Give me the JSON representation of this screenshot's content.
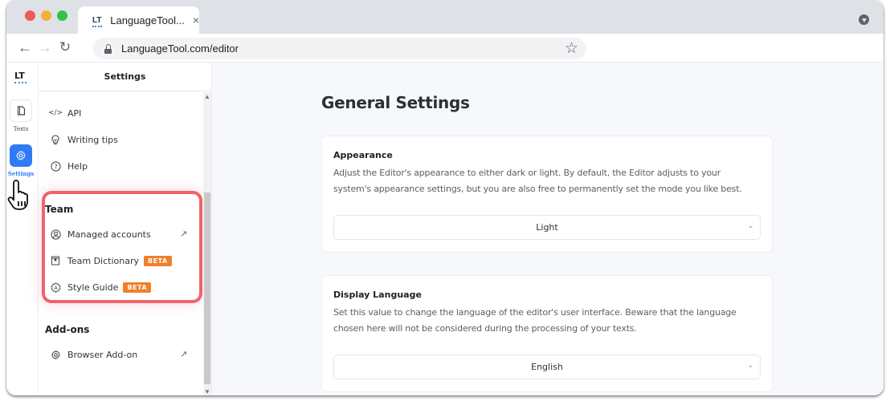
{
  "browser": {
    "tab_title": "LanguageTool...",
    "tab_favicon": "LT",
    "tab_close": "×",
    "url": "LanguageTool.com/editor",
    "nav": {
      "back": "←",
      "forward": "→",
      "reload": "↻"
    },
    "bookmark_icon": "☆"
  },
  "rail": {
    "logo": "LT",
    "items": [
      {
        "label": "Texts",
        "icon": "document-icon",
        "active": false
      },
      {
        "label": "Settings",
        "icon": "gear-icon",
        "active": true
      }
    ]
  },
  "settings_panel": {
    "title": "Settings",
    "items": [
      {
        "label": "API",
        "icon": "code-icon",
        "glyph": "</>"
      },
      {
        "label": "Writing tips",
        "icon": "lightbulb-icon",
        "glyph": "💡"
      },
      {
        "label": "Help",
        "icon": "help-icon",
        "glyph": "?"
      }
    ],
    "team": {
      "title": "Team",
      "items": [
        {
          "label": "Managed accounts",
          "icon": "user-circle-icon",
          "external": true
        },
        {
          "label": "Team Dictionary",
          "icon": "book-icon",
          "badge": "BETA"
        },
        {
          "label": "Style Guide",
          "icon": "style-guide-icon",
          "badge": "BETA"
        }
      ]
    },
    "addons": {
      "title": "Add-ons",
      "items": [
        {
          "label": "Browser Add-on",
          "icon": "gear-icon",
          "external": true
        }
      ]
    },
    "external_glyph": "↗"
  },
  "main": {
    "title": "General Settings",
    "cards": [
      {
        "title": "Appearance",
        "description": "Adjust the Editor's appearance to either dark or light. By default, the Editor adjusts to your system's appearance settings, but you are also free to permanently set the mode you like best.",
        "select_value": "Light"
      },
      {
        "title": "Display Language",
        "description": "Set this value to change the language of the editor's user interface. Beware that the language chosen here will not be considered during the processing of your texts.",
        "select_value": "English"
      }
    ]
  },
  "colors": {
    "accent": "#2f7bf5",
    "highlight": "#f1636b",
    "beta_badge": "#f07f2a"
  }
}
